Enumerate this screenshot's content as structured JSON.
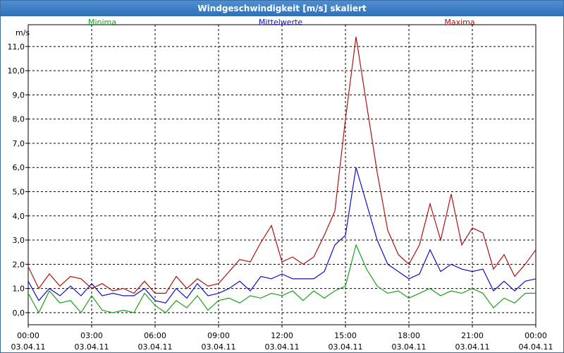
{
  "window": {
    "title": "Windgeschwindigkeit [m/s] skaliert"
  },
  "colors": {
    "min": "#1aa01a",
    "mean": "#1010c0",
    "max": "#b01010",
    "grid": "#000000"
  },
  "chart_data": {
    "type": "line",
    "title": "Windgeschwindigkeit [m/s] skaliert",
    "ylabel": "m/s",
    "ylim": [
      -0.5,
      11.9
    ],
    "xlim": [
      0,
      24
    ],
    "yticks": [
      "0,0",
      "1,0",
      "2,0",
      "3,0",
      "4,0",
      "5,0",
      "6,0",
      "7,0",
      "8,0",
      "9,0",
      "10,0",
      "11,0"
    ],
    "ytick_values": [
      0,
      1,
      2,
      3,
      4,
      5,
      6,
      7,
      8,
      9,
      10,
      11
    ],
    "xticks": [
      {
        "time": "00:00",
        "date": "03.04.11"
      },
      {
        "time": "03:00",
        "date": "03.04.11"
      },
      {
        "time": "06:00",
        "date": "03.04.11"
      },
      {
        "time": "09:00",
        "date": "03.04.11"
      },
      {
        "time": "12:00",
        "date": "03.04.11"
      },
      {
        "time": "15:00",
        "date": "03.04.11"
      },
      {
        "time": "18:00",
        "date": "03.04.11"
      },
      {
        "time": "21:00",
        "date": "03.04.11"
      },
      {
        "time": "00:00",
        "date": "04.04.11"
      }
    ],
    "xtick_values": [
      0,
      3,
      6,
      9,
      12,
      15,
      18,
      21,
      24
    ],
    "grid": true,
    "legend_placement": "top",
    "series": [
      {
        "name": "Minima",
        "x": [
          0,
          0.5,
          1,
          1.5,
          2,
          2.5,
          3,
          3.5,
          4,
          4.5,
          5,
          5.5,
          6,
          6.5,
          7,
          7.5,
          8,
          8.5,
          9,
          9.5,
          10,
          10.5,
          11,
          11.5,
          12,
          12.5,
          13,
          13.5,
          14,
          14.5,
          15,
          15.5,
          16,
          16.5,
          17,
          17.5,
          18,
          18.5,
          19,
          19.5,
          20,
          20.5,
          21,
          21.5,
          22,
          22.5,
          23,
          23.5,
          24
        ],
        "values": [
          0.8,
          0.0,
          0.9,
          0.4,
          0.5,
          0.0,
          0.7,
          0.1,
          0.0,
          0.1,
          0.0,
          0.8,
          0.3,
          0.0,
          0.5,
          0.2,
          0.7,
          0.1,
          0.5,
          0.6,
          0.4,
          0.7,
          0.6,
          0.8,
          0.7,
          0.9,
          0.5,
          0.9,
          0.6,
          0.9,
          1.1,
          2.8,
          1.8,
          1.1,
          0.8,
          0.9,
          0.6,
          0.8,
          1.0,
          0.7,
          0.9,
          0.8,
          1.0,
          0.8,
          0.2,
          0.6,
          0.4,
          0.8,
          0.8
        ]
      },
      {
        "name": "Mittelwerte",
        "x": [
          0,
          0.5,
          1,
          1.5,
          2,
          2.5,
          3,
          3.5,
          4,
          4.5,
          5,
          5.5,
          6,
          6.5,
          7,
          7.5,
          8,
          8.5,
          9,
          9.5,
          10,
          10.5,
          11,
          11.5,
          12,
          12.5,
          13,
          13.5,
          14,
          14.5,
          15,
          15.5,
          16,
          16.5,
          17,
          17.5,
          18,
          18.5,
          19,
          19.5,
          20,
          20.5,
          21,
          21.5,
          22,
          22.5,
          23,
          23.5,
          24
        ],
        "values": [
          1.3,
          0.5,
          1.0,
          0.7,
          1.1,
          0.7,
          1.2,
          0.7,
          0.8,
          0.7,
          0.7,
          1.0,
          0.5,
          0.4,
          1.0,
          0.6,
          1.2,
          0.7,
          0.8,
          1.0,
          1.3,
          0.9,
          1.5,
          1.4,
          1.6,
          1.4,
          1.4,
          1.4,
          1.7,
          2.8,
          3.2,
          6.0,
          4.5,
          3.0,
          2.0,
          1.7,
          1.4,
          1.6,
          2.6,
          1.7,
          2.0,
          1.8,
          1.7,
          1.8,
          0.9,
          1.3,
          0.9,
          1.3,
          1.4
        ]
      },
      {
        "name": "Maxima",
        "x": [
          0,
          0.5,
          1,
          1.5,
          2,
          2.5,
          3,
          3.5,
          4,
          4.5,
          5,
          5.5,
          6,
          6.5,
          7,
          7.5,
          8,
          8.5,
          9,
          9.5,
          10,
          10.5,
          11,
          11.5,
          12,
          12.5,
          13,
          13.5,
          14,
          14.5,
          15,
          15.5,
          16,
          16.5,
          17,
          17.5,
          18,
          18.5,
          19,
          19.5,
          20,
          20.5,
          21,
          21.5,
          22,
          22.5,
          23,
          23.5,
          24
        ],
        "values": [
          1.9,
          1.0,
          1.6,
          1.1,
          1.5,
          1.4,
          1.0,
          1.2,
          0.9,
          1.0,
          0.8,
          1.3,
          0.8,
          0.8,
          1.5,
          1.0,
          1.4,
          1.1,
          1.2,
          1.7,
          2.2,
          2.1,
          2.9,
          3.6,
          2.1,
          2.3,
          2.0,
          2.3,
          3.2,
          4.2,
          8.0,
          11.4,
          8.6,
          5.8,
          3.4,
          2.4,
          2.0,
          2.8,
          4.5,
          3.0,
          4.9,
          2.8,
          3.5,
          3.3,
          1.8,
          2.4,
          1.5,
          2.0,
          2.6
        ]
      }
    ]
  }
}
